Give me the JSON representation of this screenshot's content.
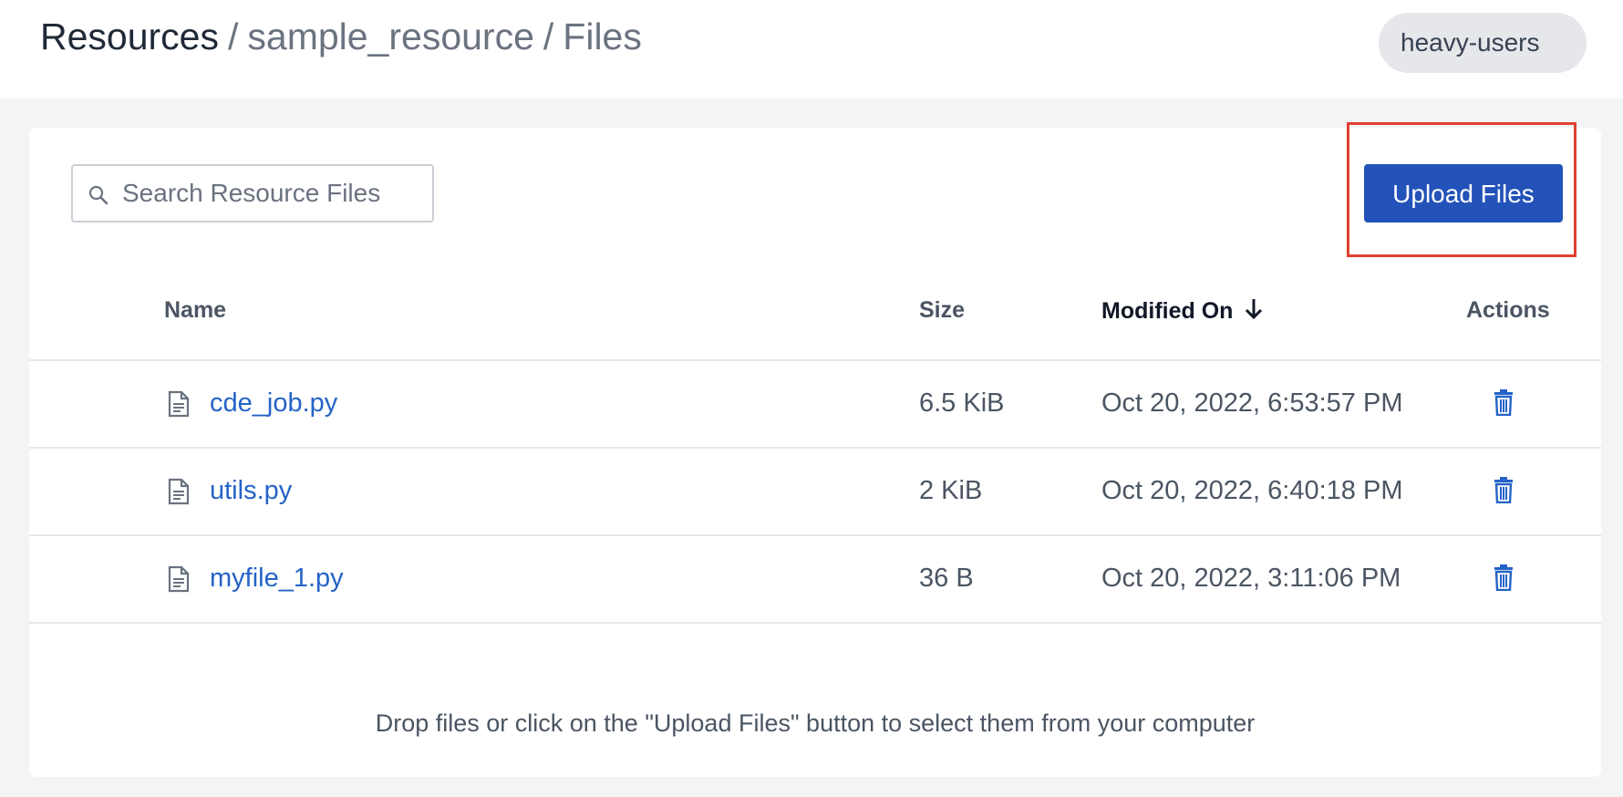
{
  "breadcrumb": {
    "root": "Resources",
    "separator": "/",
    "resource": "sample_resource",
    "current": "Files"
  },
  "user_badge": "heavy-users",
  "search": {
    "placeholder": "Search Resource Files",
    "value": ""
  },
  "upload_button": "Upload Files",
  "table": {
    "columns": [
      {
        "label": "Name"
      },
      {
        "label": "Size"
      },
      {
        "label": "Modified On",
        "sorted": "descending"
      },
      {
        "label": "Actions"
      }
    ],
    "rows": [
      {
        "name": "cde_job.py",
        "size": "6.5 KiB",
        "modified": "Oct 20, 2022, 6:53:57 PM"
      },
      {
        "name": "utils.py",
        "size": "2 KiB",
        "modified": "Oct 20, 2022, 6:40:18 PM"
      },
      {
        "name": "myfile_1.py",
        "size": "36 B",
        "modified": "Oct 20, 2022, 3:11:06 PM"
      }
    ]
  },
  "drop_hint": "Drop files or click on the \"Upload Files\" button to select them from your computer",
  "colors": {
    "accent": "#2352b9",
    "link": "#2563c7",
    "highlight_border": "#e1402f",
    "background": "#f3f4f6"
  },
  "icons": {
    "search": "search-icon",
    "file": "file-icon",
    "delete": "trash-icon",
    "sort": "arrow-down-icon"
  }
}
